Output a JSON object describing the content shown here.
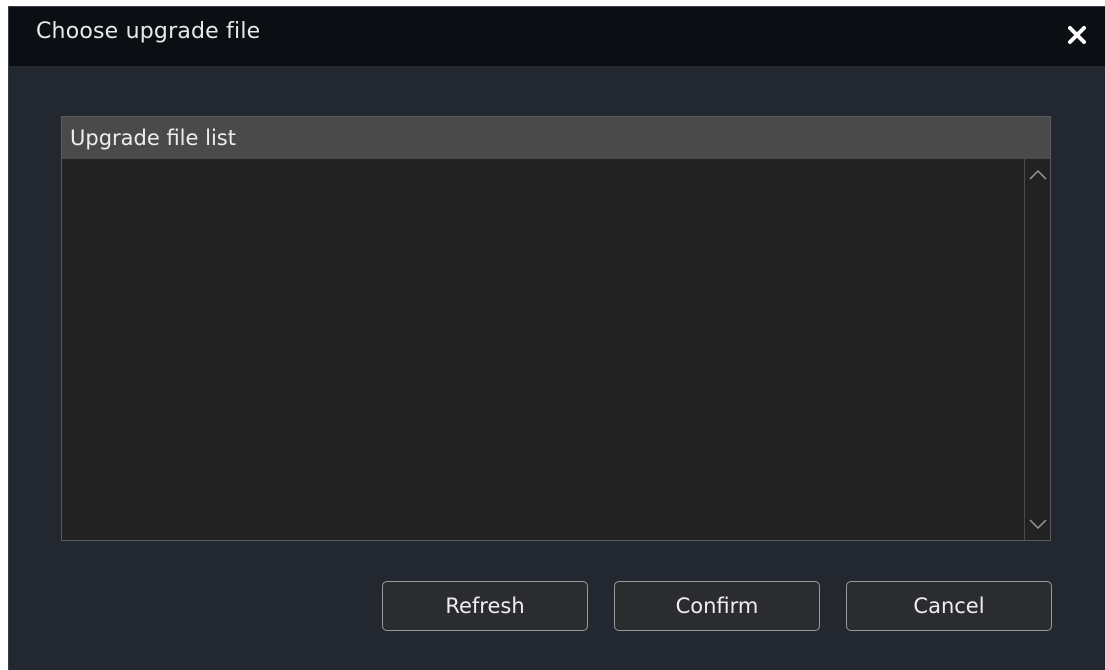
{
  "dialog": {
    "title": "Choose upgrade file",
    "close_icon": "close-icon"
  },
  "file_list": {
    "header": "Upgrade file list",
    "items": [],
    "scroll_up_icon": "chevron-up-icon",
    "scroll_down_icon": "chevron-down-icon"
  },
  "buttons": {
    "refresh": "Refresh",
    "confirm": "Confirm",
    "cancel": "Cancel"
  },
  "colors": {
    "title_bar": "#0b0f14",
    "dialog_bg": "#232830",
    "list_header_bg": "#4a4a4a",
    "list_bg": "#222222",
    "text": "#e8e8e8"
  }
}
